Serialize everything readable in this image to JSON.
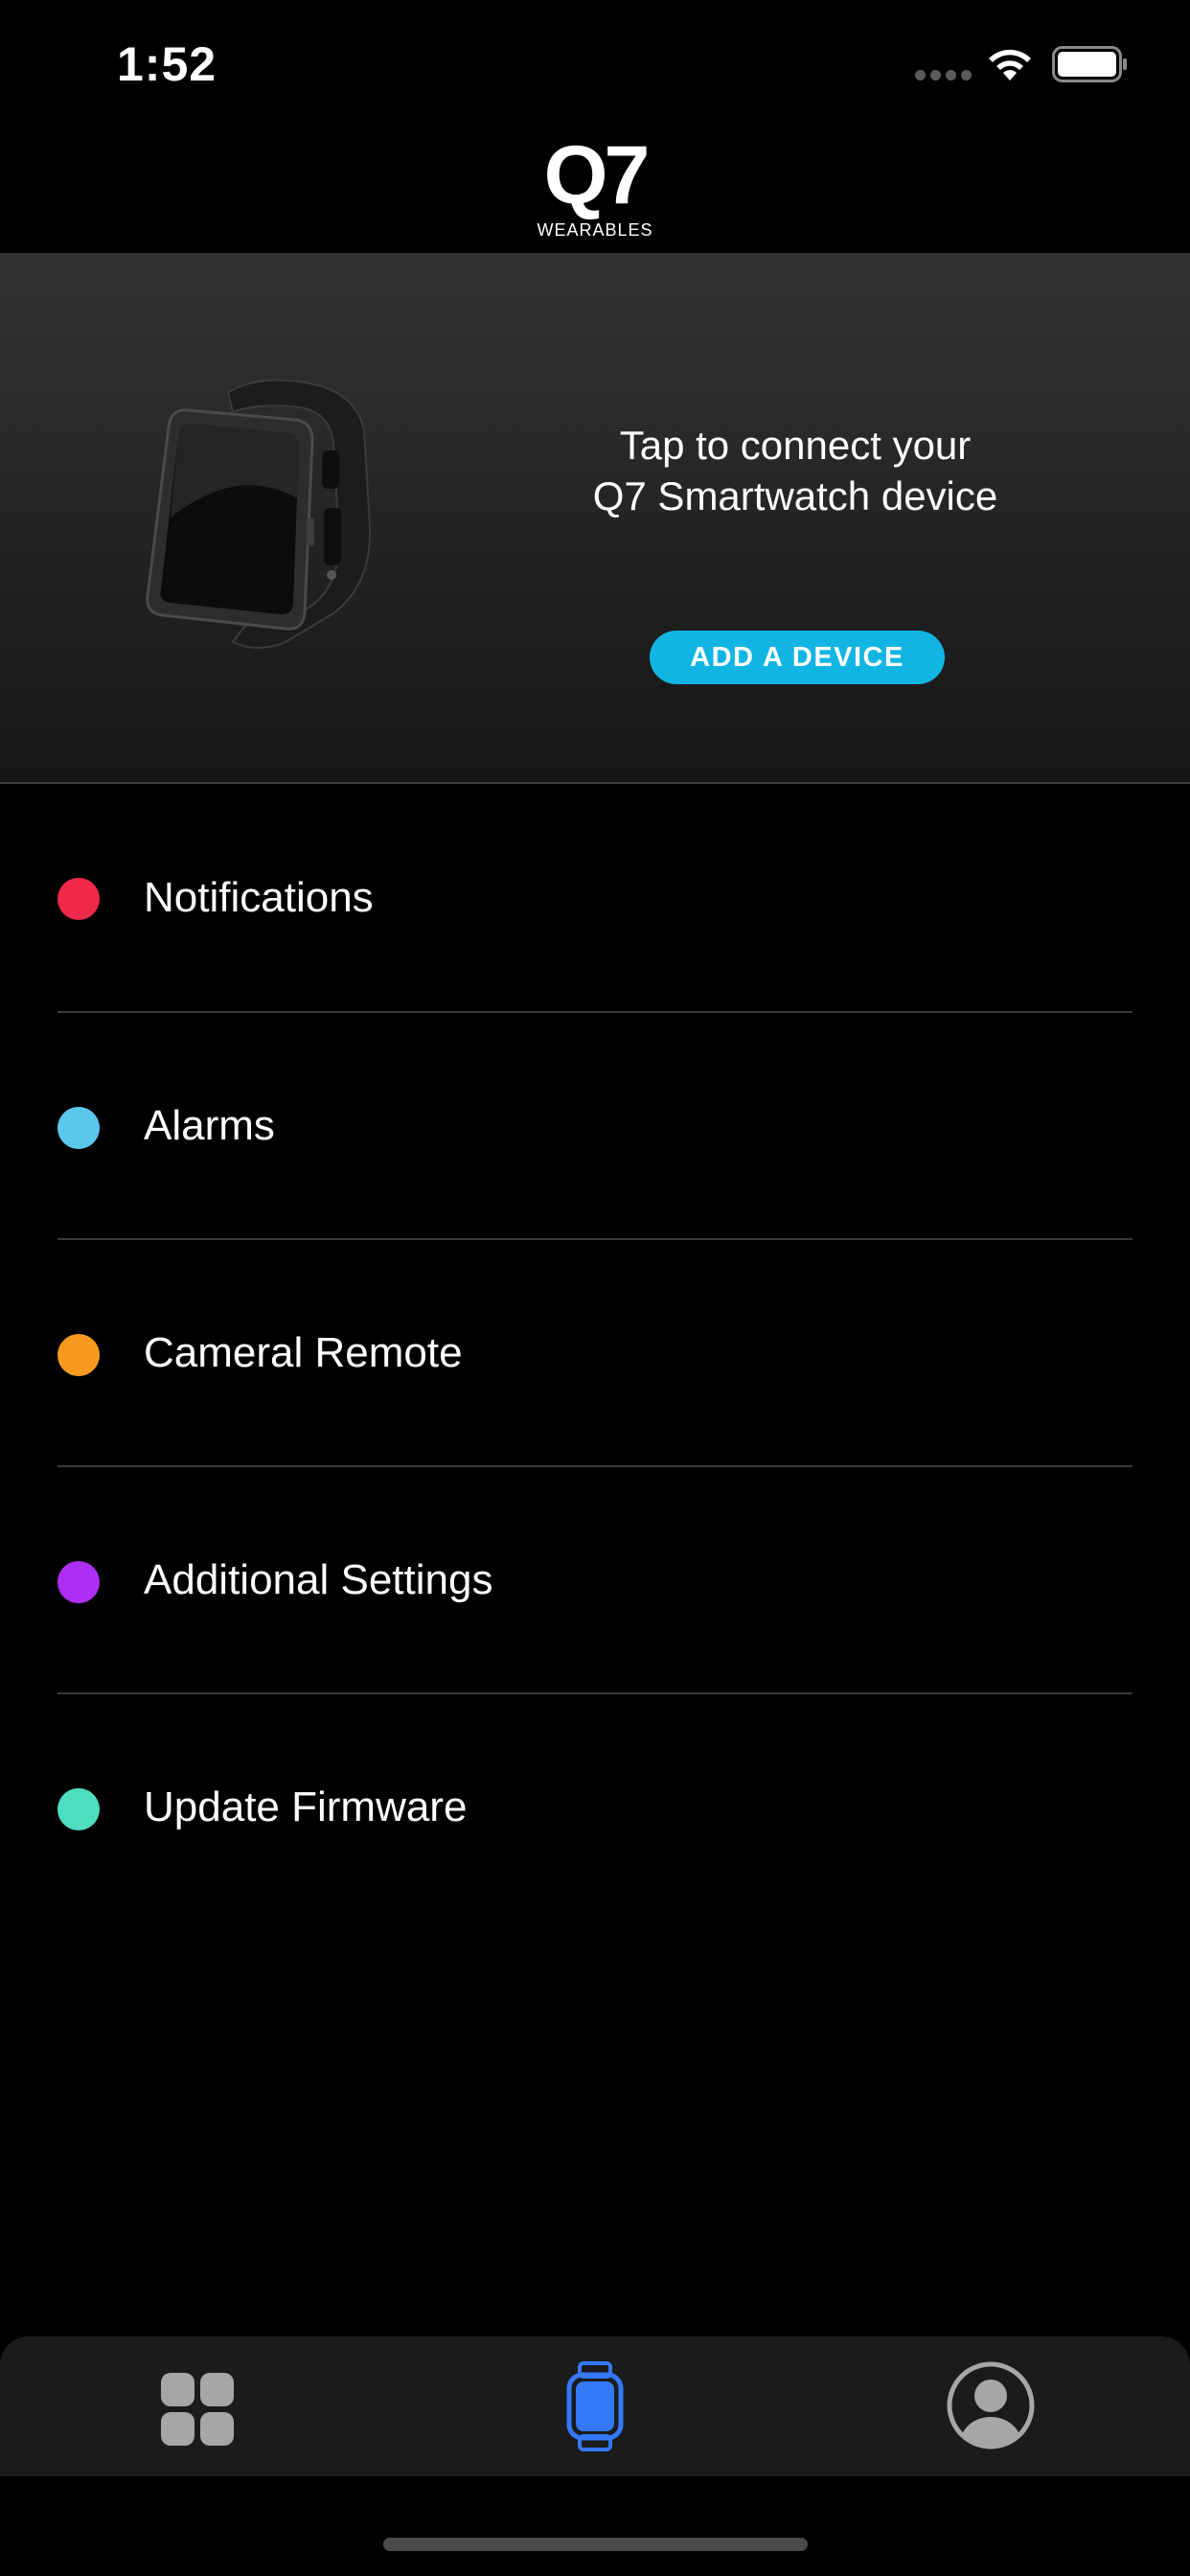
{
  "status_bar": {
    "time": "1:52",
    "icons": [
      "signal-icon",
      "wifi-icon",
      "battery-icon"
    ]
  },
  "logo": {
    "mark": "Q7",
    "subtitle": "WEARABLES"
  },
  "hero": {
    "image": "smartwatch-image",
    "prompt_line1": "Tap to connect your",
    "prompt_line2": "Q7 Smartwatch device",
    "button_label": "ADD A DEVICE",
    "button_color": "#10b5e3"
  },
  "menu": {
    "items": [
      {
        "label": "Notifications",
        "dot_color": "#f0284a"
      },
      {
        "label": "Alarms",
        "dot_color": "#5ac8ea"
      },
      {
        "label": "Cameral Remote",
        "dot_color": "#f79a1f"
      },
      {
        "label": "Additional Settings",
        "dot_color": "#ad2ff5"
      },
      {
        "label": "Update Firmware",
        "dot_color": "#4cdebe"
      }
    ]
  },
  "tab_bar": {
    "tabs": [
      {
        "icon": "dashboard-grid-icon",
        "active": false
      },
      {
        "icon": "watch-icon",
        "active": true
      },
      {
        "icon": "profile-icon",
        "active": false
      }
    ],
    "active_color": "#3478f6",
    "inactive_color": "#a6a6a6"
  }
}
